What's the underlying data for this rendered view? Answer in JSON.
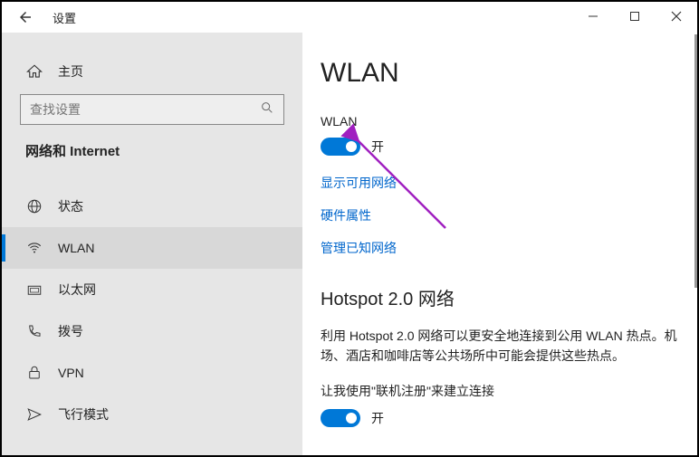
{
  "titlebar": {
    "title": "设置"
  },
  "sidebar": {
    "home": "主页",
    "search_placeholder": "查找设置",
    "category": "网络和 Internet",
    "items": [
      {
        "label": "状态"
      },
      {
        "label": "WLAN"
      },
      {
        "label": "以太网"
      },
      {
        "label": "拨号"
      },
      {
        "label": "VPN"
      },
      {
        "label": "飞行模式"
      }
    ]
  },
  "main": {
    "heading": "WLAN",
    "wlan": {
      "label": "WLAN",
      "state": "开"
    },
    "links": {
      "show_networks": "显示可用网络",
      "hw_props": "硬件属性",
      "known_networks": "管理已知网络"
    },
    "hotspot": {
      "heading": "Hotspot 2.0 网络",
      "desc": "利用 Hotspot 2.0 网络可以更安全地连接到公用 WLAN 热点。机场、酒店和咖啡店等公共场所中可能会提供这些热点。",
      "online_signup_label": "让我使用\"联机注册\"来建立连接",
      "state": "开"
    }
  }
}
